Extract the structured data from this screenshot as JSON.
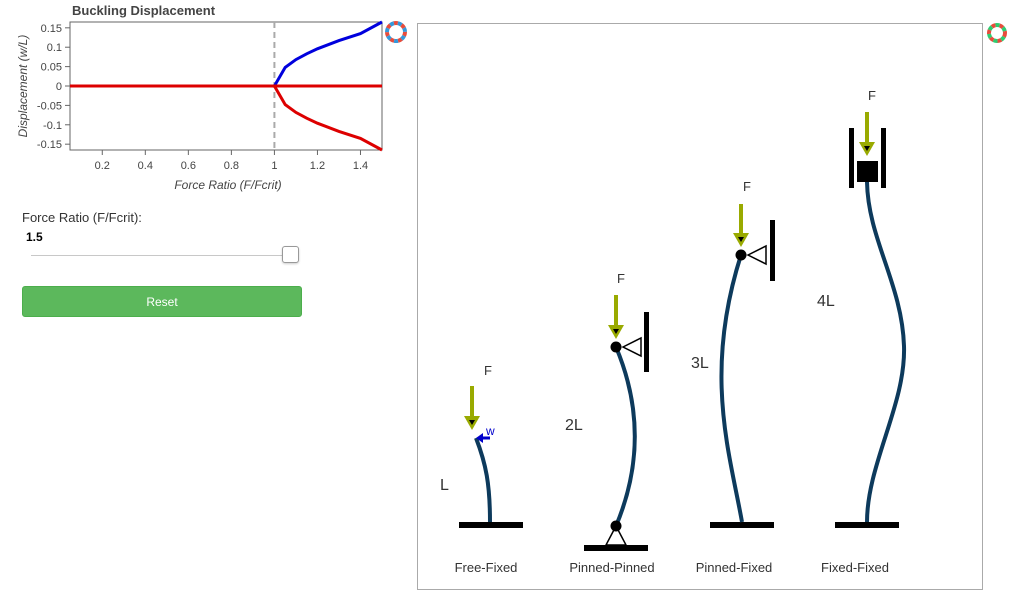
{
  "chart": {
    "title": "Buckling Displacement",
    "xlabel": "Force Ratio (F/Fcrit)",
    "ylabel": "Displacement (w/L)",
    "xticks": [
      "0.2",
      "0.4",
      "0.6",
      "0.8",
      "1",
      "1.2",
      "1.4"
    ],
    "yticks": [
      "0.15",
      "0.1",
      "0.05",
      "0",
      "-0.05",
      "-0.1",
      "-0.15"
    ]
  },
  "chart_data": {
    "type": "line",
    "title": "Buckling Displacement",
    "xlabel": "Force Ratio (F/Fcrit)",
    "ylabel": "Displacement (w/L)",
    "xlim": [
      0.05,
      1.5
    ],
    "ylim": [
      -0.165,
      0.165
    ],
    "critical_line_x": 1.0,
    "series": [
      {
        "color": "#0000dd",
        "x": [
          1.0,
          1.05,
          1.1,
          1.15,
          1.2,
          1.3,
          1.4,
          1.5
        ],
        "y": [
          0,
          0.048,
          0.068,
          0.083,
          0.096,
          0.117,
          0.135,
          0.17
        ]
      },
      {
        "color": "#dd0000",
        "x": [
          1.0,
          1.05,
          1.1,
          1.15,
          1.2,
          1.3,
          1.4,
          1.5
        ],
        "y": [
          0,
          -0.048,
          -0.068,
          -0.083,
          -0.096,
          -0.117,
          -0.135,
          -0.17
        ]
      },
      {
        "color": "#dd0000",
        "x": [
          0.05,
          1.5
        ],
        "y": [
          0,
          0
        ]
      }
    ]
  },
  "controls": {
    "force_label": "Force Ratio (F/Fcrit):",
    "force_value": "1.5",
    "force_fraction": 1.0,
    "reset_label": "Reset"
  },
  "diagram": {
    "force_label": "F",
    "displacement_label": "w",
    "columns": [
      {
        "name": "Free-Fixed",
        "length_label": "L"
      },
      {
        "name": "Pinned-Pinned",
        "length_label": "2L"
      },
      {
        "name": "Pinned-Fixed",
        "length_label": "3L"
      },
      {
        "name": "Fixed-Fixed",
        "length_label": "4L"
      }
    ]
  },
  "colors": {
    "column": "#0d3a5c",
    "arrow": "#99aa00",
    "w_arrow": "#0000cc"
  }
}
